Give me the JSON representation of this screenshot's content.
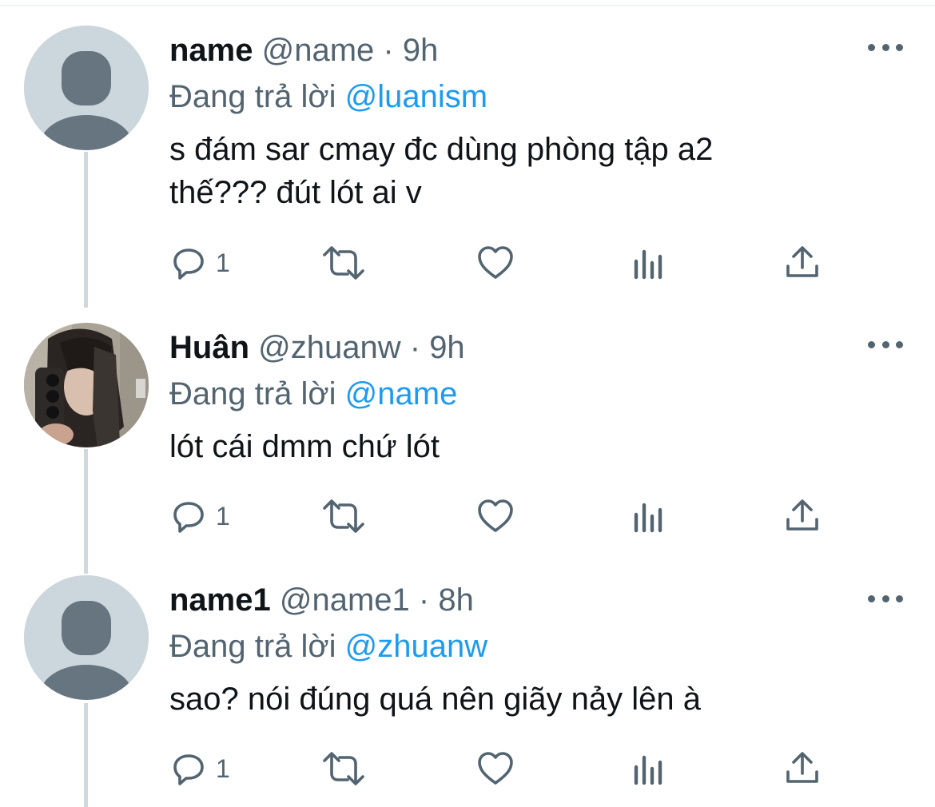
{
  "colors": {
    "text": "#0f1419",
    "secondary": "#536471",
    "link": "#1d9bf0",
    "thread_line": "#cfd9de",
    "avatar_placeholder": "#ccd6dd"
  },
  "tweets": [
    {
      "display_name": "name",
      "handle": "@name",
      "separator": "·",
      "time": "9h",
      "reply_prefix": "Đang trả lời",
      "reply_to": "@luanism",
      "text": "s đám sar cmay đc dùng phòng tập a2\nthế??? đút lót ai v",
      "avatar": "default-avatar-icon",
      "reply_count": "1"
    },
    {
      "display_name": "Huân",
      "handle": "@zhuanw",
      "separator": "·",
      "time": "9h",
      "reply_prefix": "Đang trả lời",
      "reply_to": "@name",
      "text": "lót cái dmm chứ lót",
      "avatar": "profile-photo",
      "reply_count": "1"
    },
    {
      "display_name": "name1",
      "handle": "@name1",
      "separator": "·",
      "time": "8h",
      "reply_prefix": "Đang trả lời",
      "reply_to": "@zhuanw",
      "text": "sao? nói đúng quá nên giãy nảy lên à",
      "avatar": "default-avatar-icon",
      "reply_count": "1"
    }
  ],
  "icons": {
    "more": "more-icon",
    "reply": "reply-icon",
    "retweet": "retweet-icon",
    "like": "heart-icon",
    "views": "analytics-icon",
    "share": "share-icon"
  }
}
